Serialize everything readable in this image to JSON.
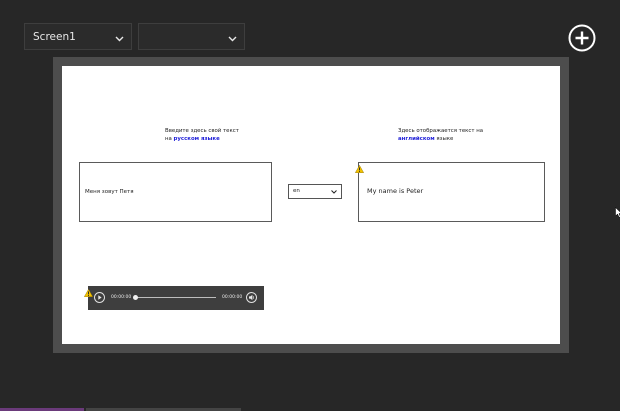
{
  "toolbar": {
    "screen_select_value": "Screen1",
    "second_select_value": ""
  },
  "canvas": {
    "input_hint_line1": "Введите здесь свой текст",
    "input_hint_prefix": "на ",
    "input_hint_lang": "русском языке",
    "output_hint_line1": "Здесь отображается текст на",
    "output_hint_lang": "английском",
    "output_hint_suffix": " языке",
    "input_text": "Меня зовут Петя",
    "language_select_value": "en",
    "output_text": "My name is Peter"
  },
  "audio": {
    "current_time": "00:00:00",
    "total_time": "00:00:00",
    "progress": 0
  },
  "colors": {
    "background": "#272727",
    "frame": "#4d4d4d",
    "canvas": "#ffffff",
    "hint_emphasis": "#1d1dd8",
    "warning": "#f2c200"
  },
  "icons": [
    "chevron-down-icon",
    "add-circle-icon",
    "warning-icon",
    "play-icon",
    "volume-icon",
    "mouse-cursor-icon"
  ]
}
